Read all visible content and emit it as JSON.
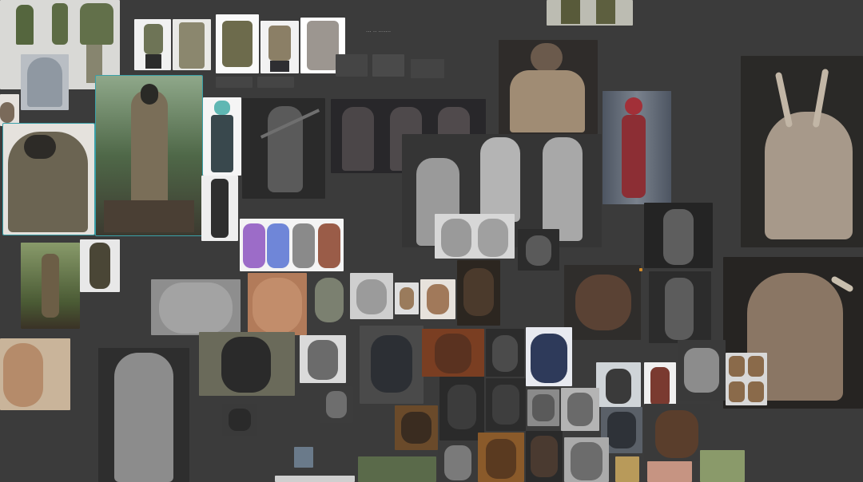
{
  "board": {
    "caption_text": "··· ·· ·······",
    "thumb_captions": [
      "",
      "",
      "",
      "",
      ""
    ]
  },
  "colors": {
    "background": "#3b3b3b",
    "selection_outline": "#3aa0a8",
    "accent_marker": "#d08a2a"
  },
  "images": [
    {
      "name": "green-jacket-sheet"
    },
    {
      "name": "hooded-jacket-grey"
    },
    {
      "name": "backpack-model"
    },
    {
      "name": "cargo-vest-a"
    },
    {
      "name": "cargo-vest-b"
    },
    {
      "name": "cargo-vest-c"
    },
    {
      "name": "hazmat-suit-forest"
    },
    {
      "name": "hooded-soldier-jacket"
    },
    {
      "name": "armored-knight"
    },
    {
      "name": "dark-knights-trio"
    },
    {
      "name": "armored-pilot"
    },
    {
      "name": "red-suit-woman"
    },
    {
      "name": "horned-orc-bust"
    },
    {
      "name": "anatomy-ecorche"
    },
    {
      "name": "gorilla-colored-turnaround"
    },
    {
      "name": "aged-face-sculpt"
    },
    {
      "name": "smiling-old-man"
    },
    {
      "name": "ape-sculpt-heads"
    },
    {
      "name": "chimp-portrait"
    },
    {
      "name": "fur-beast-render"
    },
    {
      "name": "orc-warrior-render"
    },
    {
      "name": "gorilla-photo"
    },
    {
      "name": "blue-gorilla-3d"
    },
    {
      "name": "muscle-body-sculpt"
    },
    {
      "name": "boy-portrait"
    },
    {
      "name": "gorilla-heads-grid"
    }
  ]
}
